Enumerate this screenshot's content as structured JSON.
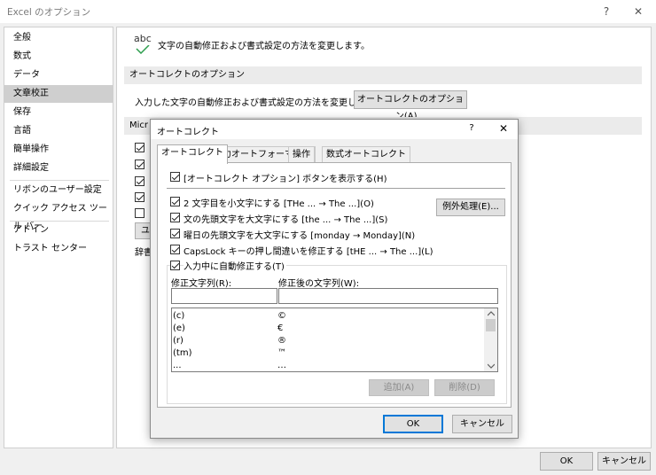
{
  "window": {
    "title": "Excel のオプション",
    "help_glyph": "?",
    "close_glyph": "✕"
  },
  "sidebar": {
    "items": [
      "全般",
      "数式",
      "データ",
      "文章校正",
      "保存",
      "言語",
      "簡単操作",
      "詳細設定",
      "リボンのユーザー設定",
      "クイック アクセス ツール バー",
      "アドイン",
      "トラスト センター"
    ]
  },
  "main": {
    "header_icon_text": "abc",
    "header_text": "文字の自動修正および書式設定の方法を変更します。",
    "autocorrect_section": {
      "title": "オートコレクトのオプション",
      "description": "入力した文字の自動修正および書式設定の方法を変更します:",
      "button_label": "オートコレクトのオプション(A)..."
    },
    "partial_section_title": "Micr",
    "partial_button_label": "ユ",
    "partial_text": "辞書"
  },
  "dialog": {
    "title": "オートコレクト",
    "help_glyph": "?",
    "close_glyph": "✕",
    "tabs": [
      "オートコレクト",
      "入力オートフォーマット",
      "操作",
      "数式オートコレクト"
    ],
    "show_buttons_option": "[オートコレクト オプション] ボタンを表示する(H)",
    "options": [
      "2 文字目を小文字にする [THe ... → The ...](O)",
      "文の先頭文字を大文字にする [the ... → The ...](S)",
      "曜日の先頭文字を大文字にする [monday → Monday](N)",
      "CapsLock キーの押し間違いを修正する [tHE ... → The ...](L)"
    ],
    "exceptions_button": "例外処理(E)...",
    "replace_while_typing": "入力中に自動修正する(T)",
    "replace_label": "修正文字列(R):",
    "with_label": "修正後の文字列(W):",
    "replace_value": "",
    "with_value": "",
    "entries": [
      {
        "from": "(c)",
        "to": "©"
      },
      {
        "from": "(e)",
        "to": "€"
      },
      {
        "from": "(r)",
        "to": "®"
      },
      {
        "from": "(tm)",
        "to": "™"
      },
      {
        "from": "...",
        "to": "…"
      }
    ],
    "add_button": "追加(A)",
    "delete_button": "削除(D)",
    "ok_button": "OK",
    "cancel_button": "キャンセル"
  },
  "footer": {
    "ok_button": "OK",
    "cancel_button": "キャンセル"
  }
}
